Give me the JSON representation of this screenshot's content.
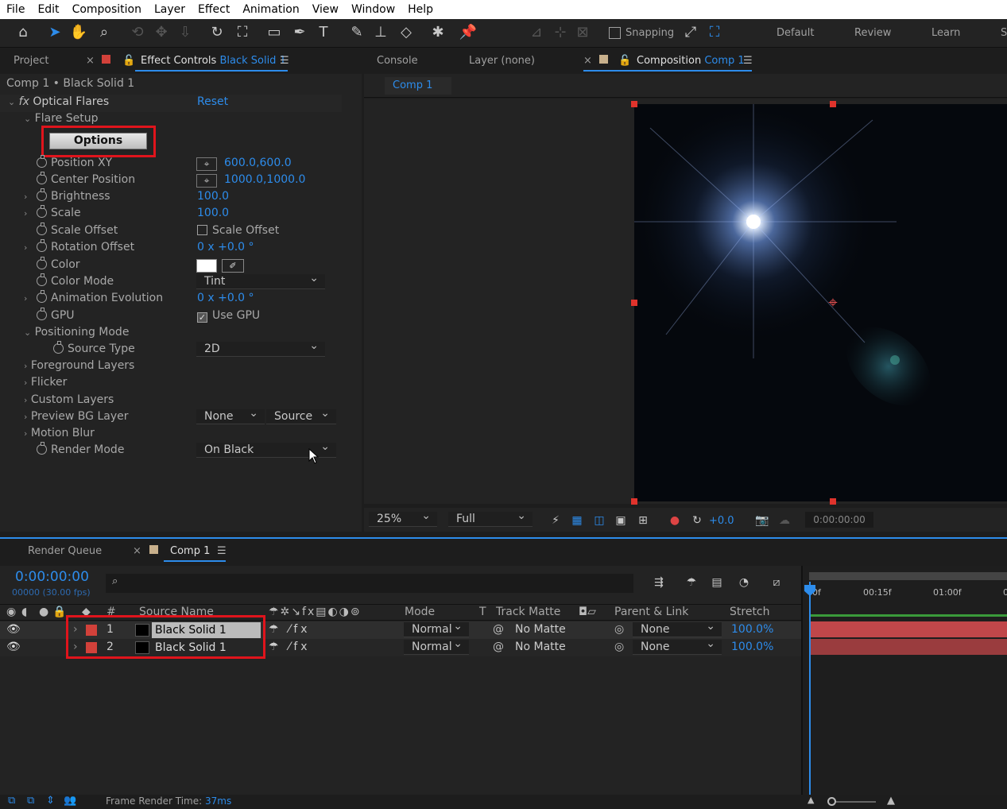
{
  "menu": [
    "File",
    "Edit",
    "Composition",
    "Layer",
    "Effect",
    "Animation",
    "View",
    "Window",
    "Help"
  ],
  "toolbar": {
    "snapping_label": "Snapping",
    "workspaces": [
      "Default",
      "Review",
      "Learn",
      "S"
    ]
  },
  "left_panel": {
    "tab_project": "Project",
    "tab_effect_controls": "Effect Controls",
    "tab_effect_target": "Black Solid 1",
    "breadcrumb": "Comp 1 • Black Solid 1",
    "effect_name": "Optical Flares",
    "reset_label": "Reset",
    "flare_setup": "Flare Setup",
    "options_label": "Options",
    "props": {
      "position_xy": {
        "label": "Position XY",
        "value": "600.0,600.0"
      },
      "center_position": {
        "label": "Center Position",
        "value": "1000.0,1000.0"
      },
      "brightness": {
        "label": "Brightness",
        "value": "100.0"
      },
      "scale": {
        "label": "Scale",
        "value": "100.0"
      },
      "scale_offset": {
        "label": "Scale Offset",
        "value": "Scale Offset"
      },
      "rotation_offset": {
        "label": "Rotation Offset",
        "value": "0 x +0.0 °"
      },
      "color": {
        "label": "Color"
      },
      "color_mode": {
        "label": "Color Mode",
        "value": "Tint"
      },
      "animation_evolution": {
        "label": "Animation Evolution",
        "value": "0 x +0.0 °"
      },
      "gpu": {
        "label": "GPU",
        "value": "Use GPU"
      },
      "positioning_mode": {
        "label": "Positioning Mode"
      },
      "source_type": {
        "label": "Source Type",
        "value": "2D"
      },
      "foreground_layers": {
        "label": "Foreground Layers"
      },
      "flicker": {
        "label": "Flicker"
      },
      "custom_layers": {
        "label": "Custom Layers"
      },
      "preview_bg_layer": {
        "label": "Preview BG Layer",
        "value1": "None",
        "value2": "Source"
      },
      "motion_blur": {
        "label": "Motion Blur"
      },
      "render_mode": {
        "label": "Render Mode",
        "value": "On Black"
      }
    }
  },
  "right_panel": {
    "tab_console": "Console",
    "tab_layer": "Layer (none)",
    "tab_composition": "Composition",
    "tab_comp_name": "Comp 1",
    "comp_subtab": "Comp 1",
    "bottom": {
      "zoom": "25%",
      "resolution": "Full",
      "exposure": "+0.0",
      "timecode": "0:00:00:00"
    }
  },
  "timeline": {
    "tab_render_queue": "Render Queue",
    "tab_comp": "Comp 1",
    "current_time": "0:00:00:00",
    "frame_info": "00000 (30.00 fps)",
    "columns": {
      "hash": "#",
      "source_name": "Source Name",
      "mode": "Mode",
      "t": "T",
      "track_matte": "Track Matte",
      "parent": "Parent & Link",
      "stretch": "Stretch"
    },
    "ruler": [
      "0f",
      "00:15f",
      "01:00f",
      "0"
    ],
    "layers": [
      {
        "num": "1",
        "name": "Black Solid 1",
        "mode": "Normal",
        "matte": "No Matte",
        "parent": "None",
        "stretch": "100.0%"
      },
      {
        "num": "2",
        "name": "Black Solid 1",
        "mode": "Normal",
        "matte": "No Matte",
        "parent": "None",
        "stretch": "100.0%"
      }
    ],
    "status_label": "Frame Render Time:",
    "status_value": "37ms"
  }
}
